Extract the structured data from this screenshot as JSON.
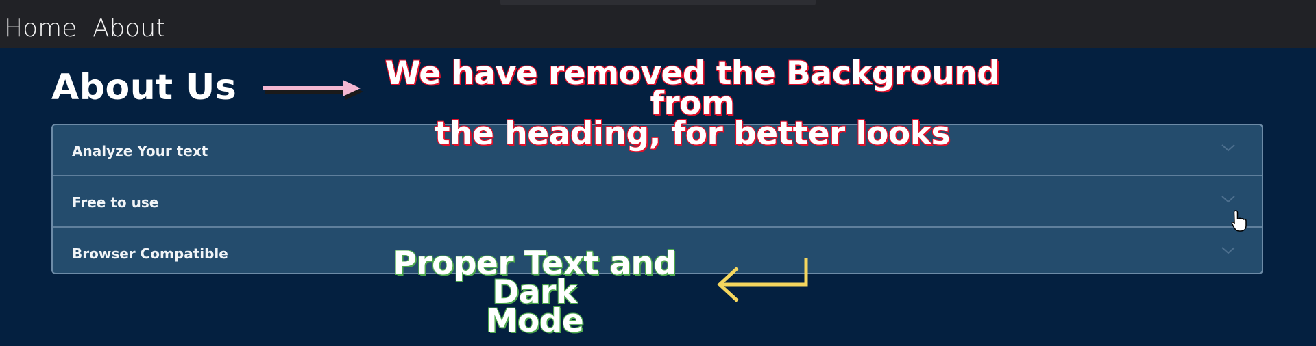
{
  "nav": {
    "links": [
      {
        "label": "Home"
      },
      {
        "label": "About"
      }
    ]
  },
  "page": {
    "title": "About Us"
  },
  "accordion": {
    "items": [
      {
        "label": "Analyze Your text",
        "expanded": false
      },
      {
        "label": "Free to use",
        "expanded": false
      },
      {
        "label": "Browser Compatible",
        "expanded": false
      }
    ]
  },
  "annotations": {
    "top_line1": "We have removed the Background from",
    "top_line2": "the heading, for better looks",
    "bottom_line1": "Proper Text and Dark",
    "bottom_line2": "Mode"
  },
  "colors": {
    "background": "#042040",
    "navbar": "#212226",
    "accordion_bg": "#244c6d",
    "annotation_top_outline": "#e0102a",
    "annotation_bottom_outline": "#4ea84e",
    "arrow_pink": "#f5b8d2",
    "arrow_yellow": "#f5d65e"
  },
  "icons": {
    "accordion_toggle": "chevron-down-icon",
    "pointer": "hand-pointer-icon",
    "annotation_arrow_right": "arrow-right-icon",
    "annotation_arrow_return": "return-arrow-icon"
  }
}
